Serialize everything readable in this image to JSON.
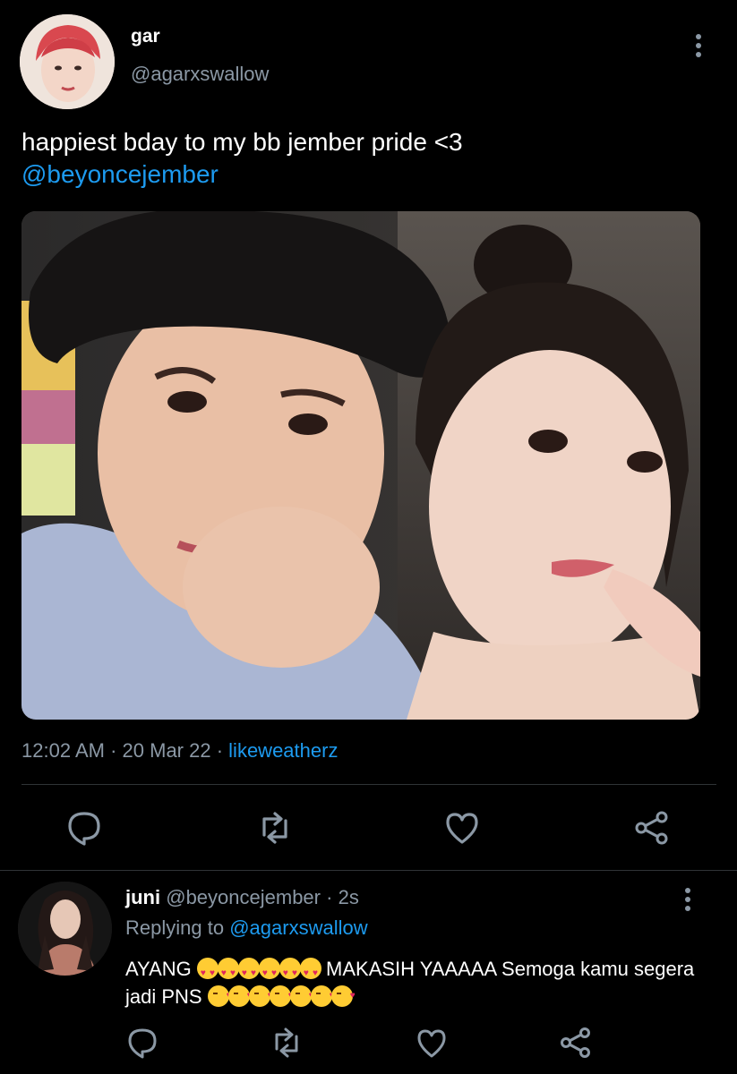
{
  "tweet": {
    "display_name": "gar",
    "handle": "@agarxswallow",
    "text": "happiest bday to my bb jember pride <3",
    "mention": "@beyoncejember",
    "time": "12:02 AM",
    "date": "20 Mar 22",
    "source": "likeweatherz",
    "media_alt": "photo"
  },
  "reply": {
    "display_name": "juni",
    "handle": "@beyoncejember",
    "age": "2s",
    "replying_label": "Replying to",
    "replying_to": "@agarxswallow",
    "text_part1": "AYANG",
    "text_part2": "MAKASIH YAAAAA  Semoga kamu segera jadi PNS",
    "heart_eyes_count": 6,
    "kiss_count": 7
  },
  "icons": [
    "reply-icon",
    "retweet-icon",
    "like-icon",
    "share-icon",
    "more-icon"
  ],
  "colors": {
    "background": "#000000",
    "accent": "#1d9bf0",
    "muted": "#8b98a5",
    "text": "#ffffff"
  }
}
